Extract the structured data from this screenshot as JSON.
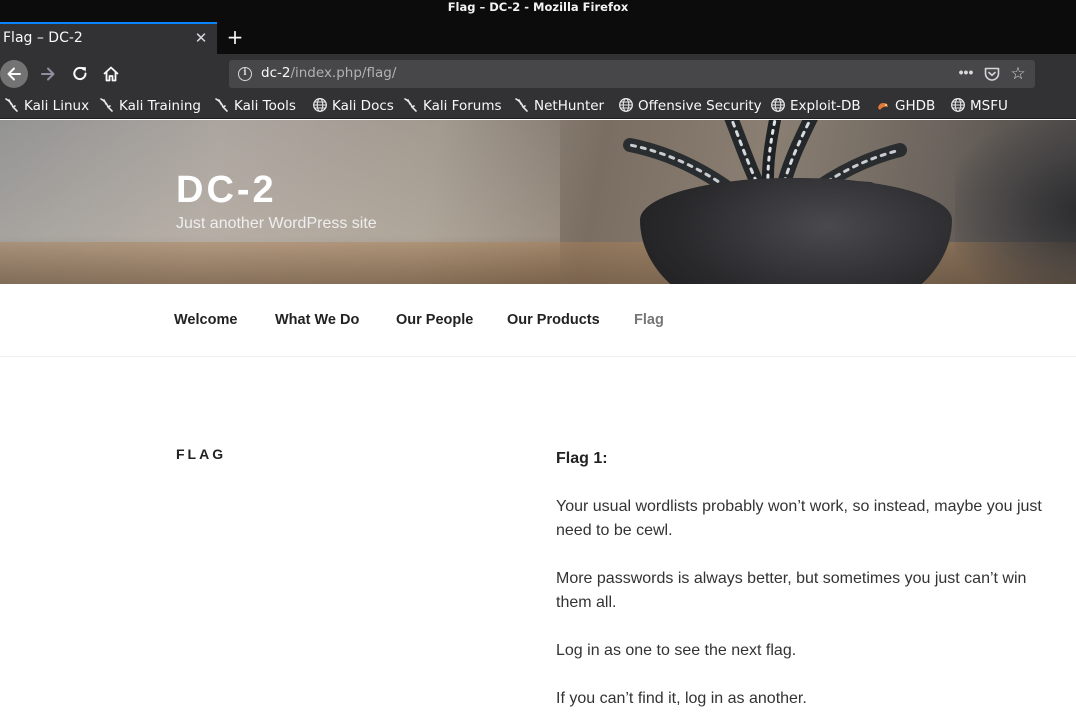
{
  "window": {
    "title": "Flag – DC-2 - Mozilla Firefox"
  },
  "tabs": [
    {
      "title": "Flag – DC-2",
      "close": "✕"
    }
  ],
  "toolbar": {
    "new_tab": "+",
    "url_host": "dc-2",
    "url_path": "/index.php/flag/",
    "icons": [
      "back-icon",
      "forward-icon",
      "reload-icon",
      "home-icon",
      "info-icon",
      "more-icon",
      "pocket-icon",
      "bookmark-star-icon"
    ]
  },
  "bookmarks": [
    {
      "label": "Kali Linux",
      "icon": "kali-dragon-icon"
    },
    {
      "label": "Kali Training",
      "icon": "kali-dragon-icon"
    },
    {
      "label": "Kali Tools",
      "icon": "kali-dragon-icon"
    },
    {
      "label": "Kali Docs",
      "icon": "globe-icon"
    },
    {
      "label": "Kali Forums",
      "icon": "kali-dragon-icon"
    },
    {
      "label": "NetHunter",
      "icon": "kali-dragon-icon"
    },
    {
      "label": "Offensive Security",
      "icon": "globe-icon"
    },
    {
      "label": "Exploit-DB",
      "icon": "globe-icon"
    },
    {
      "label": "GHDB",
      "icon": "ghdb-icon"
    },
    {
      "label": "MSFU",
      "icon": "globe-icon"
    }
  ],
  "site": {
    "title": "DC-2",
    "description": "Just another WordPress site"
  },
  "menu": {
    "items": [
      {
        "label": "Welcome"
      },
      {
        "label": "What We Do"
      },
      {
        "label": "Our People"
      },
      {
        "label": "Our Products"
      },
      {
        "label": "Flag"
      }
    ],
    "current": "Flag"
  },
  "page": {
    "title": "FLAG",
    "paragraphs": [
      "Flag 1:",
      "Your usual wordlists probably won’t work, so instead, maybe you just need to be cewl.",
      "More passwords is always better, but sometimes you just can’t win them all.",
      "Log in as one to see the next flag.",
      "If you can’t find it, log in as another."
    ]
  },
  "colors": {
    "chrome_dark": "#0c0c0d",
    "toolbar": "#323234",
    "tab_accent": "#0a84ff",
    "urlbar": "#474749",
    "menu_current": "#767676"
  }
}
